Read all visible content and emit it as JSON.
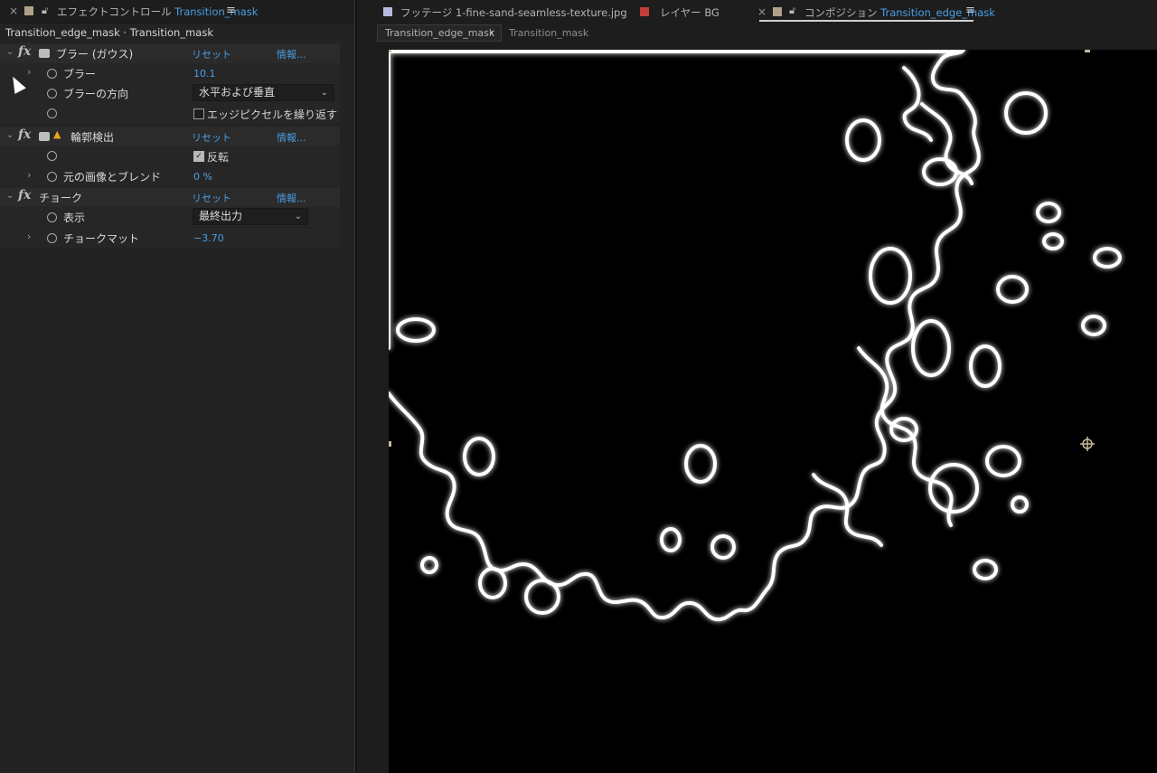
{
  "effect_controls": {
    "close_label": "×",
    "tab_prefix": "エフェクトコントロール",
    "tab_layer": "Transition_mask",
    "menu_glyph": "≡",
    "layer_path": "Transition_edge_mask · Transition_mask",
    "fx_glyph": "fx",
    "warning_glyph": "▲",
    "expand_glyph": "›",
    "collapse_glyph": "⌄",
    "dropdown_glyph": "⌄",
    "check_glyph": "✓",
    "effects": [
      {
        "name": "ブラー (ガウス)",
        "reset": "リセット",
        "info": "情報...",
        "properties": [
          {
            "label": "ブラー",
            "value": "10.1"
          },
          {
            "label": "ブラーの方向",
            "value": "水平および垂直"
          },
          {
            "label": "エッジピクセルを繰り返す",
            "checked": false
          }
        ]
      },
      {
        "name": "輪郭検出",
        "reset": "リセット",
        "info": "情報...",
        "properties": [
          {
            "label": "反転",
            "checked": true
          },
          {
            "label": "元の画像とブレンド",
            "value": "0 %"
          }
        ]
      },
      {
        "name": "チョーク",
        "reset": "リセット",
        "info": "情報...",
        "properties": [
          {
            "label": "表示",
            "value": "最終出力"
          },
          {
            "label": "チョークマット",
            "value": "−3.70"
          }
        ]
      }
    ]
  },
  "right_tabs": {
    "footage": {
      "prefix": "フッテージ",
      "name": "1-fine-sand-seamless-texture.jpg"
    },
    "layer": {
      "prefix": "レイヤー",
      "name": "BG"
    },
    "composition": {
      "close_label": "×",
      "prefix": "コンポジション",
      "name": "Transition_edge_mask",
      "menu_glyph": "≡"
    }
  },
  "comp_nav": {
    "active": "Transition_edge_mask",
    "separator": "‹",
    "parent": "Transition_mask"
  },
  "colors": {
    "accent": "#4a9ee3",
    "footage_label": "#b8b8dc",
    "layer_label": "#c43b3b",
    "comp_label": "#b0a288",
    "warning": "#e8a81e"
  }
}
